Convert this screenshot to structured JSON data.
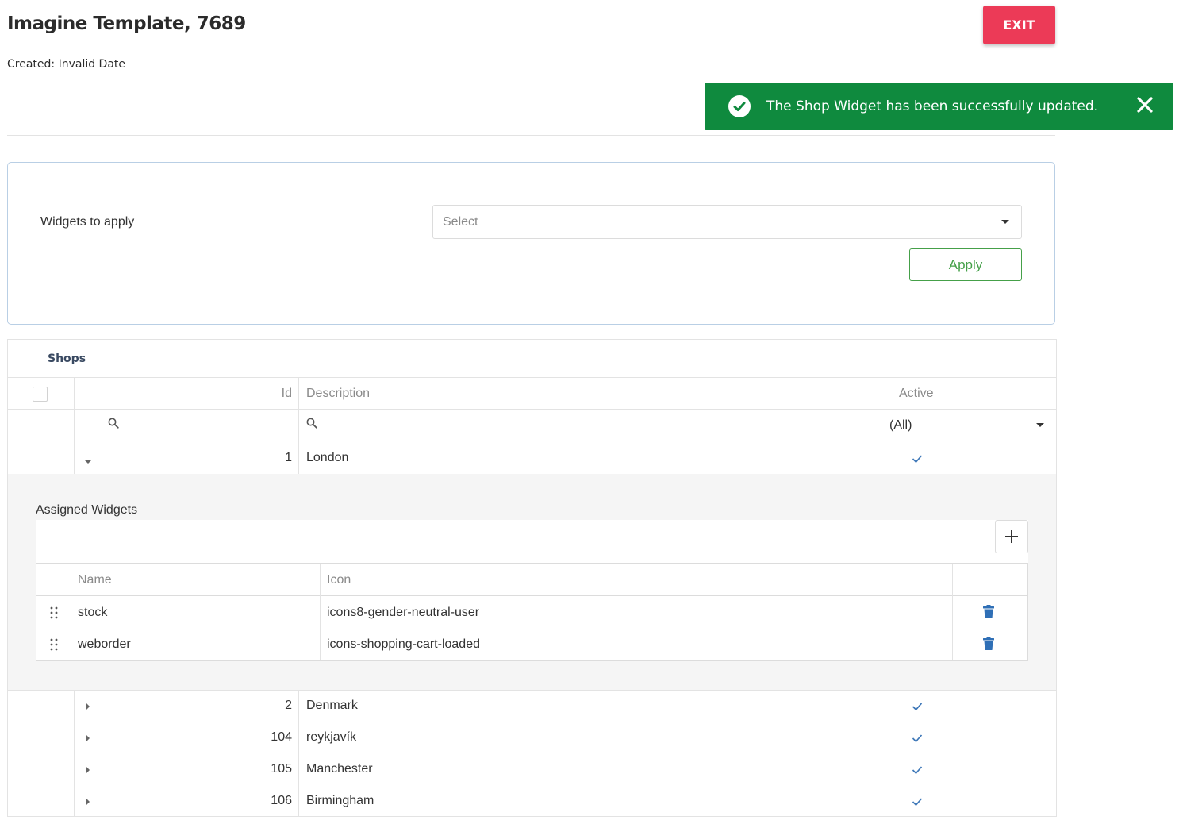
{
  "header": {
    "title": "Imagine Template, 7689",
    "created": "Created: Invalid Date",
    "exit_label": "EXIT"
  },
  "toast": {
    "message": "The Shop Widget has been successfully updated.",
    "color": "#0f8a3e"
  },
  "widgets_panel": {
    "label": "Widgets to apply",
    "select_placeholder": "Select",
    "apply_label": "Apply"
  },
  "shops": {
    "caption": "Shops",
    "columns": {
      "id": "Id",
      "description": "Description",
      "active": "Active"
    },
    "filter_active": "(All)",
    "rows": [
      {
        "id": "1",
        "description": "London",
        "active": true,
        "expanded": true
      },
      {
        "id": "2",
        "description": "Denmark",
        "active": true,
        "expanded": false
      },
      {
        "id": "104",
        "description": "reykjavík",
        "active": true,
        "expanded": false
      },
      {
        "id": "105",
        "description": "Manchester",
        "active": true,
        "expanded": false
      },
      {
        "id": "106",
        "description": "Birmingham",
        "active": true,
        "expanded": false
      }
    ]
  },
  "assigned_widgets": {
    "label": "Assigned Widgets",
    "columns": {
      "name": "Name",
      "icon": "Icon"
    },
    "rows": [
      {
        "name": "stock",
        "icon": "icons8-gender-neutral-user"
      },
      {
        "name": "weborder",
        "icon": "icons-shopping-cart-loaded"
      }
    ]
  },
  "colors": {
    "exit": "#ec3a57",
    "apply": "#45a049",
    "check": "#3d77b8",
    "trash": "#2f6fb6"
  }
}
